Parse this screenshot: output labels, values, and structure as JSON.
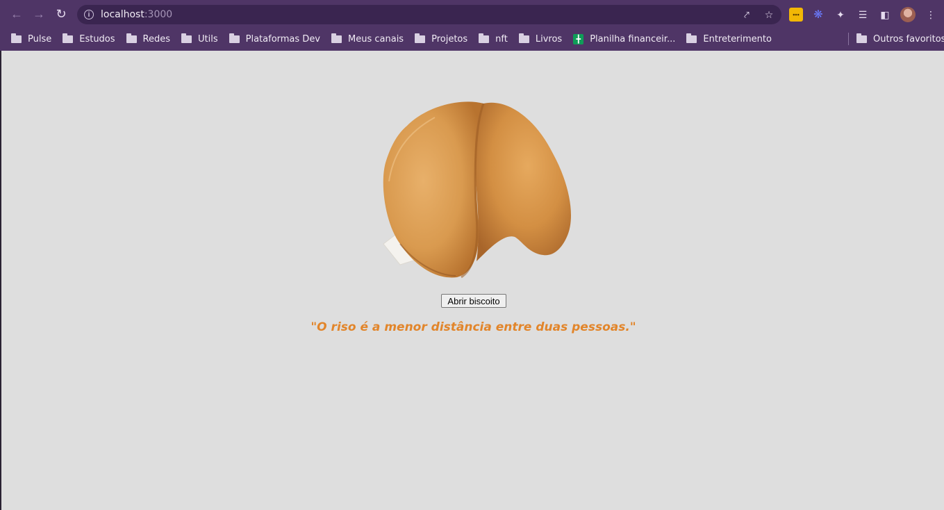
{
  "browser": {
    "url_host": "localhost",
    "url_port": ":3000",
    "bookmarks": [
      {
        "label": "Pulse",
        "type": "folder"
      },
      {
        "label": "Estudos",
        "type": "folder"
      },
      {
        "label": "Redes",
        "type": "folder"
      },
      {
        "label": "Utils",
        "type": "folder"
      },
      {
        "label": "Plataformas Dev",
        "type": "folder"
      },
      {
        "label": "Meus canais",
        "type": "folder"
      },
      {
        "label": "Projetos",
        "type": "folder"
      },
      {
        "label": "nft",
        "type": "folder"
      },
      {
        "label": "Livros",
        "type": "folder"
      },
      {
        "label": "Planilha financeir...",
        "type": "sheet"
      },
      {
        "label": "Entreterimento",
        "type": "folder"
      }
    ],
    "other_bookmarks": "Outros favoritos",
    "theme_color": "#4f3566"
  },
  "page": {
    "button_label": "Abrir biscoito",
    "fortune_text": "\"O riso é a menor distância entre duas pessoas.\"",
    "fortune_color": "#e2852a",
    "background": "#dedede"
  }
}
